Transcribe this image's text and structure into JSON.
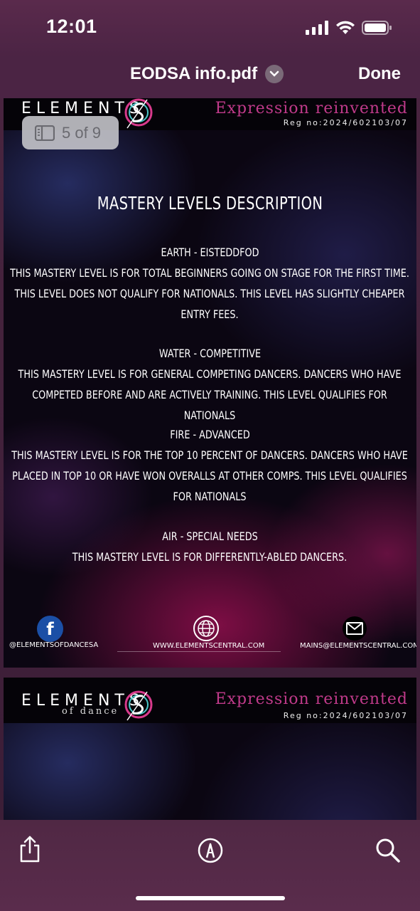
{
  "status_bar": {
    "time": "12:01"
  },
  "nav": {
    "title": "EODSA info.pdf",
    "done_label": "Done"
  },
  "page_indicator": {
    "text": "5 of 9"
  },
  "brand": {
    "name": "ELEMENTS",
    "sub": "of dance",
    "tagline": "Expression reinvented",
    "reg_no": "Reg no:2024/602103/07"
  },
  "page": {
    "title": "MASTERY LEVELS DESCRIPTION",
    "levels": [
      {
        "name": "EARTH - EISTEDDFOD",
        "description": "THIS MASTERY LEVEL IS FOR TOTAL BEGINNERS GOING ON STAGE FOR THE FIRST TIME.  THIS LEVEL DOES NOT QUALIFY FOR NATIONALS.  THIS LEVEL HAS SLIGHTLY CHEAPER ENTRY FEES."
      },
      {
        "name": "WATER - COMPETITIVE",
        "description": "THIS MASTERY LEVEL IS FOR GENERAL COMPETING DANCERS.  DANCERS WHO HAVE COMPETED BEFORE AND ARE ACTIVELY TRAINING.   THIS LEVEL QUALIFIES FOR NATIONALS"
      },
      {
        "name": "FIRE - ADVANCED",
        "description": "THIS MASTERY LEVEL IS FOR THE TOP 10 PERCENT OF DANCERS.  DANCERS WHO HAVE PLACED IN TOP 10 OR HAVE WON OVERALLS AT OTHER COMPS. THIS LEVEL QUALIFIES FOR NATIONALS"
      },
      {
        "name": "AIR - SPECIAL NEEDS",
        "description": "THIS MASTERY LEVEL IS FOR DIFFERENTLY-ABLED DANCERS."
      }
    ],
    "footer": {
      "social": "@ELEMENTSOFDANCESA",
      "website": "WWW.ELEMENTSCENTRAL.COM",
      "email": "MAINS@ELEMENTSCENTRAL.COM"
    }
  },
  "colors": {
    "accent_pink": "#c03a8a",
    "chrome": "#4b2444"
  },
  "icons": [
    "signal-icon",
    "wifi-icon",
    "battery-icon",
    "chevron-down-icon",
    "sidebar-icon",
    "facebook-icon",
    "globe-icon",
    "mail-icon",
    "share-icon",
    "markup-icon",
    "search-icon"
  ]
}
